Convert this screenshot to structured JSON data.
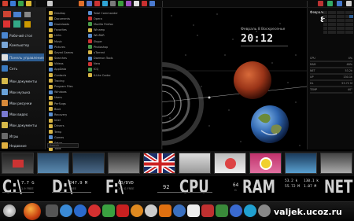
{
  "start_menu": {
    "items": [
      "Рабочий стол",
      "Компьютер",
      "Панель управления",
      "Сеть",
      "Мои документы",
      "Мои музыка",
      "Мои рисунки",
      "Мои видео",
      "Мои документы",
      "Игры",
      "Недавние"
    ]
  },
  "explorer": {
    "col1": [
      "Desktop",
      "Documents",
      "Downloads",
      "Favorites",
      "Links",
      "Music",
      "Pictures",
      "Saved Games",
      "Searches",
      "Videos",
      "AppData",
      "Contacts",
      "Tracing",
      "Program Files",
      "Windows",
      "Users",
      "PerfLogs",
      "Boot",
      "Recovery",
      "Intel",
      "Drivers",
      "Temp",
      "Games",
      "Setup",
      "Tools"
    ],
    "col2": [
      "Total Commander",
      "Opera",
      "Mozilla Firefox",
      "Winamp",
      "WinRAR",
      "Skype",
      "Photoshop",
      "uTorrent",
      "Daemon Tools",
      "Nero",
      "ICQ",
      "K-Lite Codec"
    ],
    "col3": [],
    "search": "Search"
  },
  "desktop": {
    "clock_date": "Февраль 8 Воскресенье",
    "clock": "20:12"
  },
  "gadgets": {
    "cal_month": "Февраль",
    "cal_day": "8",
    "stats": [
      {
        "k": "CPU",
        "v": "4%"
      },
      {
        "k": "RAM",
        "v": "48%"
      },
      {
        "k": "NET",
        "v": "53.2k"
      },
      {
        "k": "UP",
        "v": "130.1k"
      },
      {
        "k": "DL",
        "v": "55.72 M"
      },
      {
        "k": "TEMP",
        "v": "40°"
      }
    ]
  },
  "meters": {
    "c": {
      "letter": "C:\\",
      "value": "7.7 G",
      "sub": "1.9 FREE"
    },
    "d": {
      "letter": "D:\\",
      "value": "247.9 M",
      "sub": "FREE"
    },
    "f": {
      "letter": "F:\\",
      "value": "CD/DVD",
      "sub": "192 G FREE"
    },
    "cpu": {
      "value": "92",
      "label": "CPU"
    },
    "ram": {
      "value": "64",
      "label": "RAM",
      "sub": "G"
    },
    "net": {
      "value": "53.2 k",
      "value2": "130.1 k",
      "value3": "55.72 M",
      "value4": "1.07 M",
      "label": "NET"
    }
  },
  "watermark": "valjek.ucoz.ru",
  "colors": {
    "accent": "#2d5d92",
    "mars": "#b0401e",
    "earth": "#2f66b0"
  }
}
